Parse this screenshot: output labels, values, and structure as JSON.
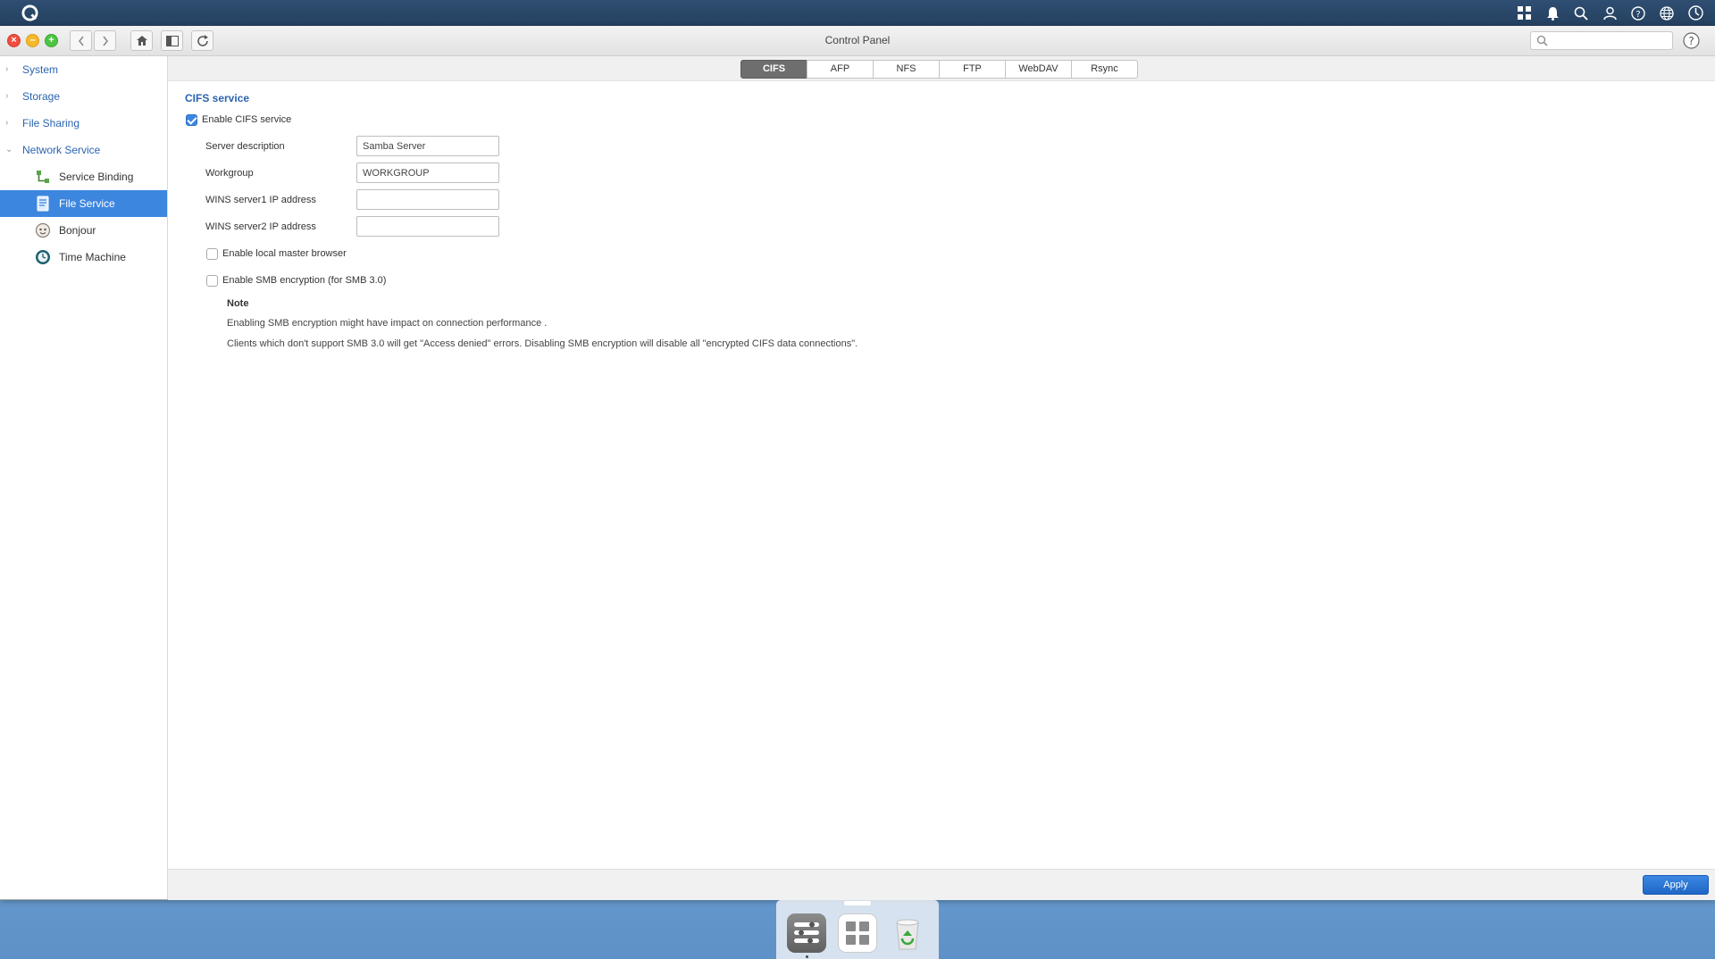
{
  "window": {
    "title": "Control Panel"
  },
  "search": {
    "placeholder": ""
  },
  "sidebar": {
    "categories": [
      {
        "label": "System"
      },
      {
        "label": "Storage"
      },
      {
        "label": "File Sharing"
      },
      {
        "label": "Network Service"
      }
    ],
    "items": [
      {
        "label": "Service Binding",
        "icon": "service-binding-icon"
      },
      {
        "label": "File Service",
        "icon": "file-service-icon",
        "active": true
      },
      {
        "label": "Bonjour",
        "icon": "bonjour-icon"
      },
      {
        "label": "Time Machine",
        "icon": "time-machine-icon"
      }
    ]
  },
  "tabs": [
    {
      "label": "CIFS",
      "active": true
    },
    {
      "label": "AFP"
    },
    {
      "label": "NFS"
    },
    {
      "label": "FTP"
    },
    {
      "label": "WebDAV"
    },
    {
      "label": "Rsync"
    }
  ],
  "cifs": {
    "section_title": "CIFS service",
    "enable_label": "Enable CIFS service",
    "enable_checked": true,
    "server_description_label": "Server description",
    "server_description_value": "Samba Server",
    "workgroup_label": "Workgroup",
    "workgroup_value": "WORKGROUP",
    "wins1_label": "WINS server1 IP address",
    "wins1_value": "",
    "wins2_label": "WINS server2 IP address",
    "wins2_value": "",
    "local_master_label": "Enable local master browser",
    "local_master_checked": false,
    "smb_encryption_label": "Enable SMB encryption (for SMB 3.0)",
    "smb_encryption_checked": false,
    "note_title": "Note",
    "note_line1": "Enabling SMB encryption might have impact on connection performance .",
    "note_line2": "Clients which don't support SMB 3.0 will get \"Access denied\" errors. Disabling SMB encryption will disable all \"encrypted CIFS data connections\"."
  },
  "footer": {
    "apply_label": "Apply"
  },
  "colors": {
    "accent": "#3d86e0",
    "section_title": "#2a64b0",
    "topbar": "#2b486a"
  }
}
